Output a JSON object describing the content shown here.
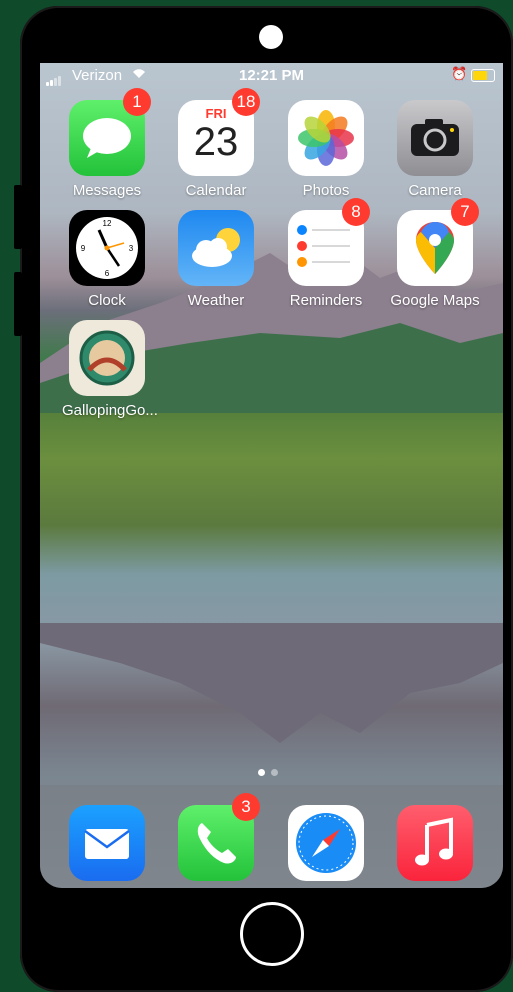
{
  "status_bar": {
    "carrier": "Verizon",
    "time": "12:21 PM"
  },
  "home_screen": {
    "apps": [
      {
        "label": "Messages",
        "badge": "1",
        "icon": "messages-icon"
      },
      {
        "label": "Calendar",
        "badge": "18",
        "icon": "calendar-icon",
        "calendar_day": "FRI",
        "calendar_date": "23"
      },
      {
        "label": "Photos",
        "badge": "",
        "icon": "photos-icon"
      },
      {
        "label": "Camera",
        "badge": "",
        "icon": "camera-icon"
      },
      {
        "label": "Clock",
        "badge": "",
        "icon": "clock-icon"
      },
      {
        "label": "Weather",
        "badge": "",
        "icon": "weather-icon"
      },
      {
        "label": "Reminders",
        "badge": "8",
        "icon": "reminders-icon"
      },
      {
        "label": "Google Maps",
        "badge": "7",
        "icon": "google-maps-icon"
      },
      {
        "label": "GallopingGo...",
        "badge": "",
        "icon": "galloping-gourmet-icon"
      }
    ],
    "page_indicator": {
      "pages": 2,
      "current": 1
    }
  },
  "dock": {
    "apps": [
      {
        "name": "Mail",
        "icon": "mail-icon",
        "badge": ""
      },
      {
        "name": "Phone",
        "icon": "phone-icon",
        "badge": "3"
      },
      {
        "name": "Safari",
        "icon": "safari-icon",
        "badge": ""
      },
      {
        "name": "Music",
        "icon": "music-icon",
        "badge": ""
      }
    ]
  },
  "colors": {
    "background": "#0f4a2a",
    "badge": "#ff3b30",
    "battery": "#ffd60a"
  }
}
